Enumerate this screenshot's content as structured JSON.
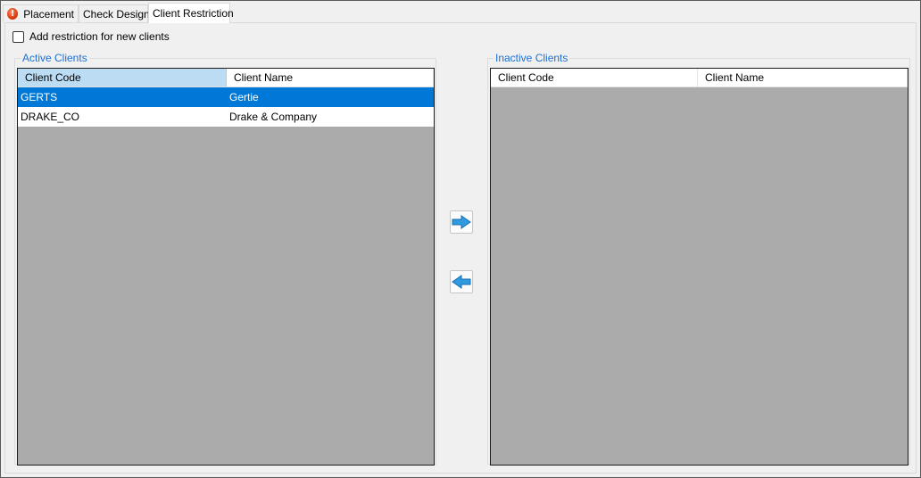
{
  "tabs": [
    {
      "label": "Placement",
      "has_error": true
    },
    {
      "label": "Check Design"
    },
    {
      "label": "Client Restriction",
      "active": true
    }
  ],
  "restriction_checkbox": {
    "label": "Add restriction for new clients",
    "checked": false
  },
  "active_clients": {
    "title": "Active Clients",
    "columns": [
      "Client Code",
      "Client Name"
    ],
    "rows": [
      {
        "code": "GERTS",
        "name": "Gertie",
        "selected": true
      },
      {
        "code": "DRAKE_CO",
        "name": "Drake & Company",
        "selected": false
      }
    ]
  },
  "inactive_clients": {
    "title": "Inactive Clients",
    "columns": [
      "Client Code",
      "Client Name"
    ],
    "rows": []
  },
  "buttons": {
    "move_right_icon": "arrow-right-icon",
    "move_left_icon": "arrow-left-icon"
  },
  "colors": {
    "group_label": "#1e6fd0",
    "selection": "#0078d7",
    "sorted_header": "#bcdcf4",
    "grid_empty": "#ababab",
    "arrow": "#2f9ae0"
  }
}
